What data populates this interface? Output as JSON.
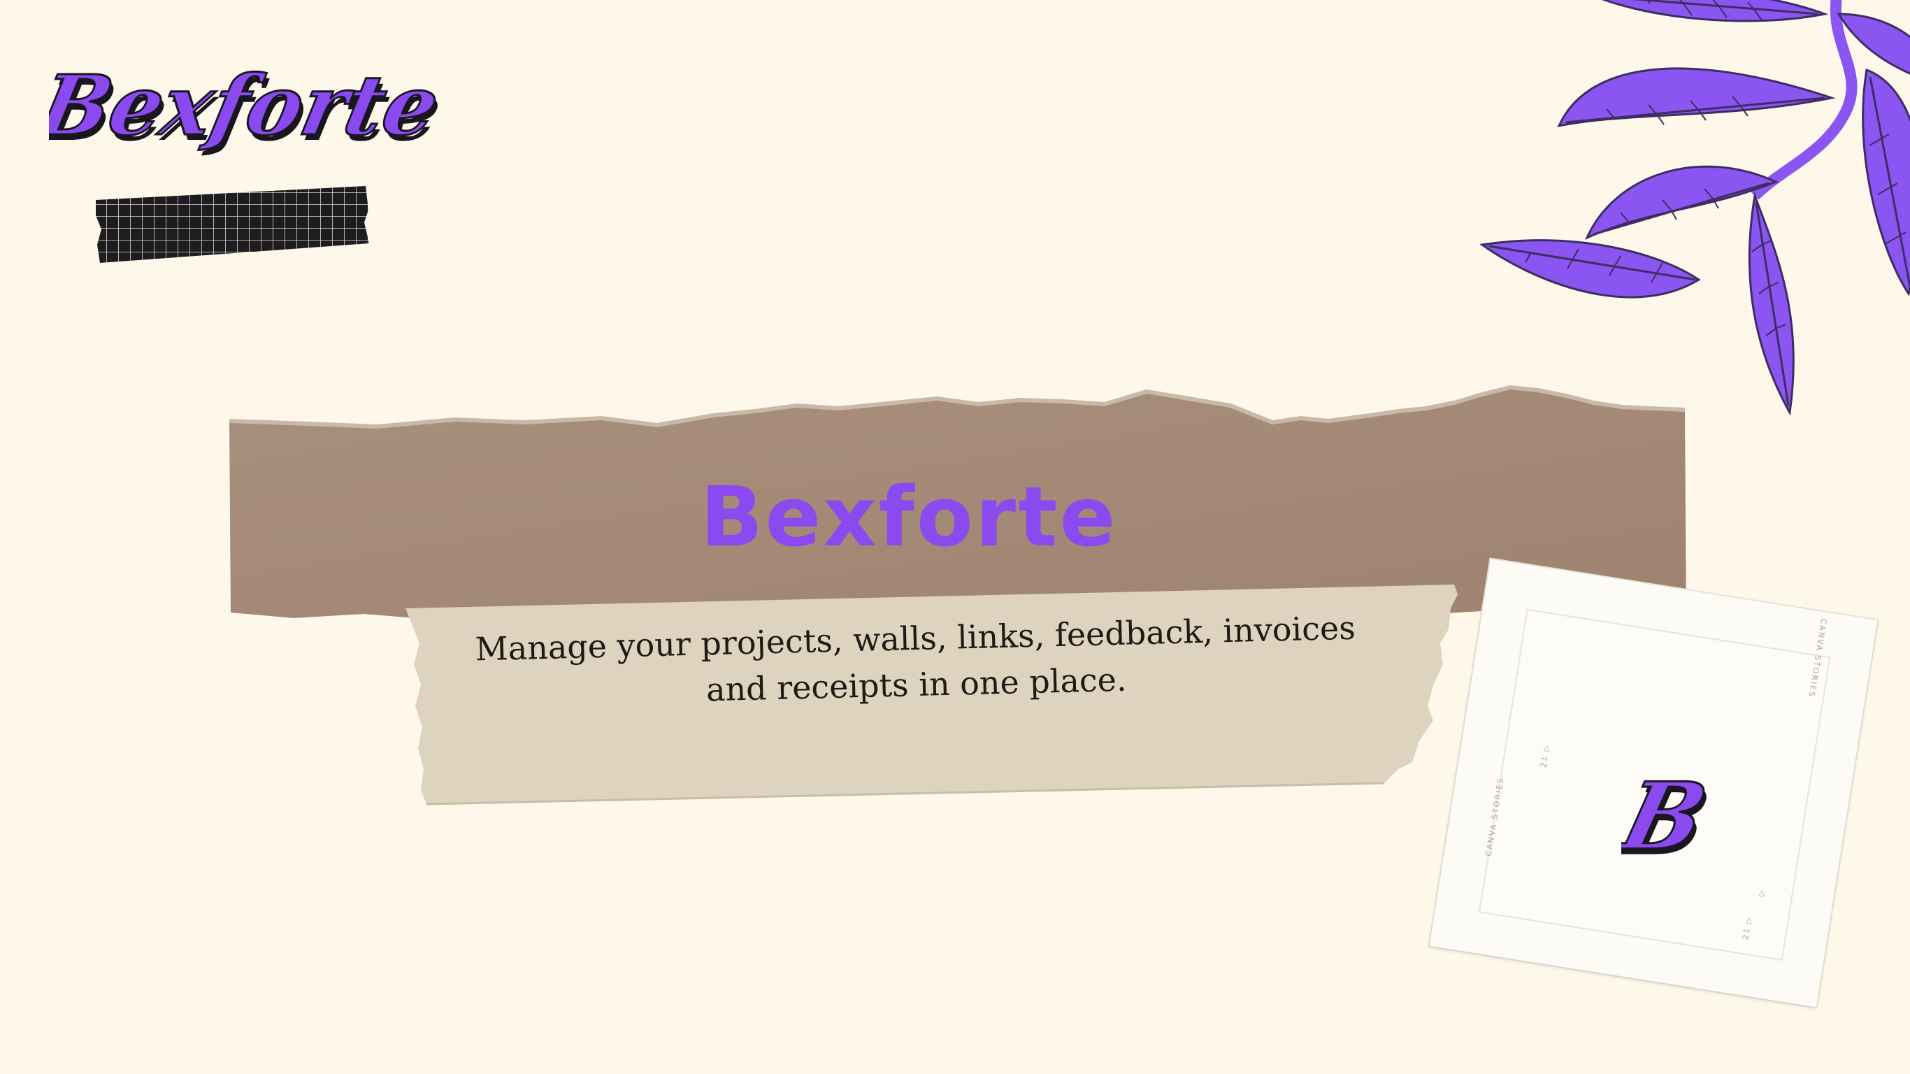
{
  "brand": {
    "script_logo": "Bexforte",
    "title": "Bexforte",
    "tagline_line1": "Manage your projects, walls, links, feedback, invoices",
    "tagline_line2": "and receipts in one place.",
    "monogram": "B"
  },
  "polaroid": {
    "edge_text_top": "CANVA STORIES",
    "edge_text_bottom": "CANVA STORIES",
    "marker_1": "21 ▷",
    "marker_2": "▷",
    "marker_3": "21 ▷"
  },
  "colors": {
    "background": "#fdf8ea",
    "accent_purple": "#8b4af0",
    "leaf_purple": "#8a55f0",
    "kraft_paper": "#a88e7c",
    "masking_tape": "#ddd3be",
    "grid_tape": "#1e1c1e"
  },
  "icons": {
    "decoration_top_right": "purple-leaves",
    "decoration_top_left": "grid-washi-tape",
    "monogram_mark": "b-monogram"
  }
}
